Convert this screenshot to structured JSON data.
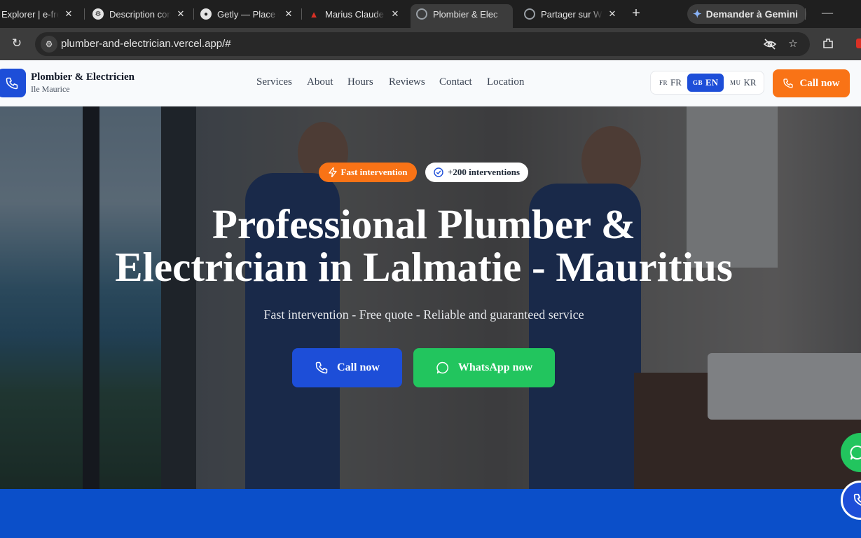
{
  "browser": {
    "tabs": [
      {
        "title": "Explorer | e-free",
        "favicon": "explorer-favicon"
      },
      {
        "title": "Description con",
        "favicon": "chatgpt-favicon"
      },
      {
        "title": "Getly — Place d",
        "favicon": "getly-favicon"
      },
      {
        "title": "Marius Claude I",
        "favicon": "triangle-favicon"
      },
      {
        "title": "Plombier & Elec",
        "favicon": "globe-favicon",
        "active": true
      },
      {
        "title": "Partager sur Wh",
        "favicon": "globe-favicon"
      }
    ],
    "gemini_label": "Demander à Gemini",
    "url": "plumber-and-electrician.vercel.app/#"
  },
  "header": {
    "brand_name": "Plombier & Electricien",
    "brand_sub": "Ile Maurice",
    "nav": [
      "Services",
      "About",
      "Hours",
      "Reviews",
      "Contact",
      "Location"
    ],
    "languages": [
      {
        "code": "FR",
        "label": "FR",
        "active": false
      },
      {
        "code": "GB",
        "label": "EN",
        "active": true
      },
      {
        "code": "MU",
        "label": "KR",
        "active": false
      }
    ],
    "call_label": "Call now"
  },
  "hero": {
    "badge_fast": "Fast intervention",
    "badge_count": "+200 interventions",
    "title_line1": "Professional Plumber &",
    "title_line2": "Electrician in Lalmatie - Mauritius",
    "subtitle": "Fast intervention - Free quote - Reliable and guaranteed service",
    "call_label": "Call now",
    "whatsapp_label": "WhatsApp now"
  },
  "colors": {
    "primary_blue": "#1d4ed8",
    "accent_orange": "#f97316",
    "whatsapp_green": "#22c55e"
  }
}
